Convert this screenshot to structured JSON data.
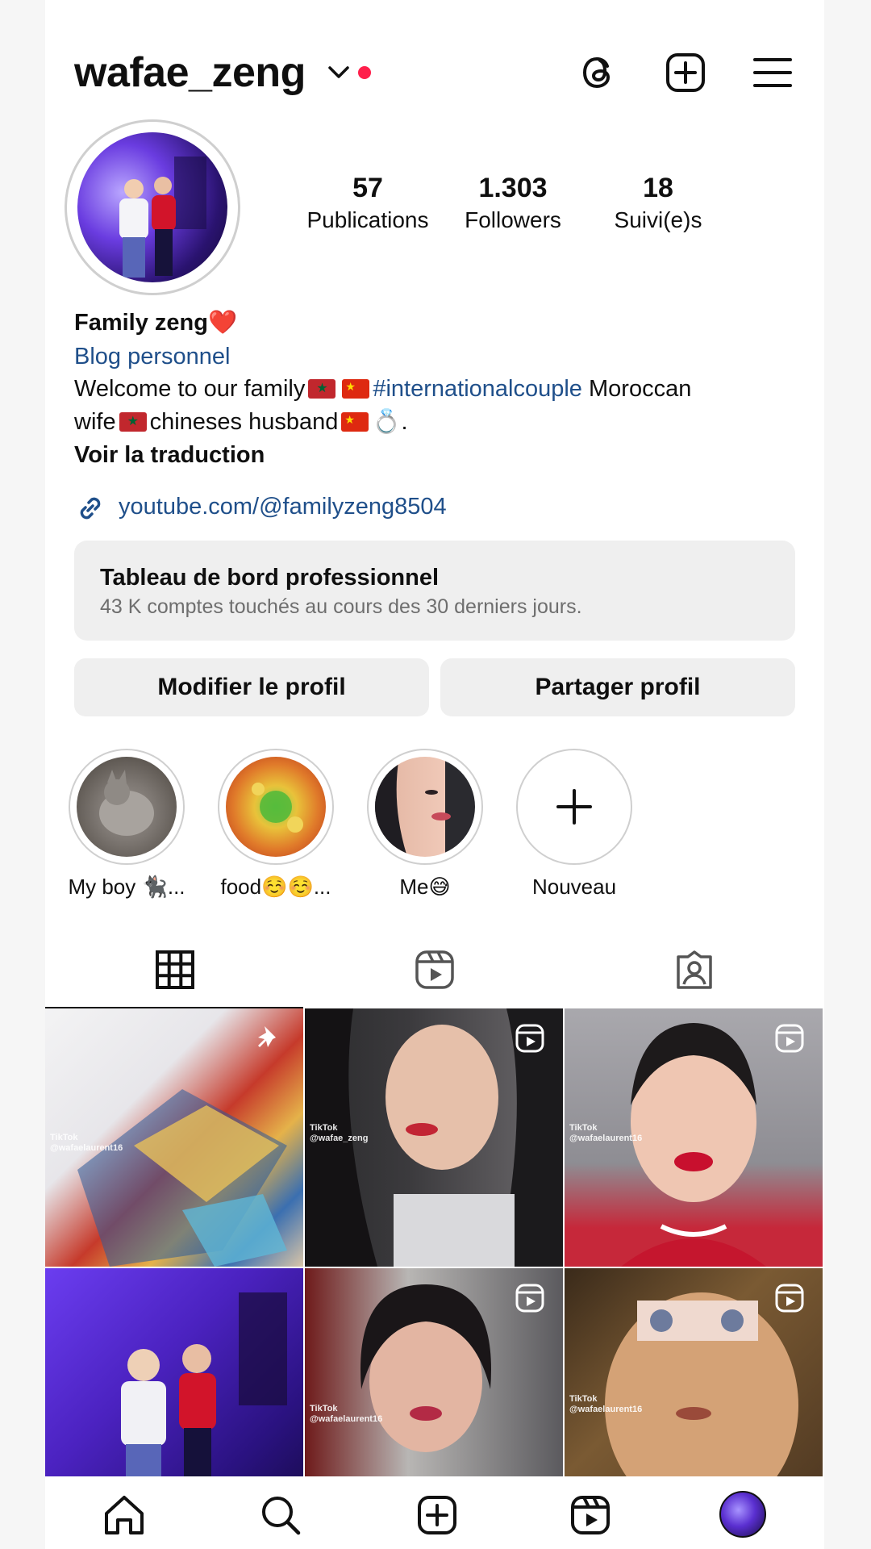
{
  "header": {
    "username": "wafae_zeng",
    "icons": [
      "threads-icon",
      "create-icon",
      "menu-icon"
    ]
  },
  "profile": {
    "stats": [
      {
        "value": "57",
        "label": "Publications"
      },
      {
        "value": "1.303",
        "label": "Followers"
      },
      {
        "value": "18",
        "label": "Suivi(e)s"
      }
    ],
    "name": "Family zeng",
    "name_emoji": "❤️",
    "category": "Blog personnel",
    "bio_part1": "Welcome to our family",
    "bio_hashtag": "#internationalcouple",
    "bio_part2": " Moroccan",
    "bio_part3": "wife",
    "bio_part4": "chineses husband",
    "bio_ring": "💍",
    "bio_end": ".",
    "translate": "Voir la traduction",
    "link": "youtube.com/@familyzeng8504"
  },
  "dashboard": {
    "title": "Tableau de bord professionnel",
    "subtitle": "43 K comptes touchés au cours des 30 derniers jours."
  },
  "buttons": {
    "edit": "Modifier le profil",
    "share": "Partager profil"
  },
  "highlights": [
    {
      "label": "My boy 🐈‍⬛..."
    },
    {
      "label": "food☺️☺️..."
    },
    {
      "label": "Me😅"
    },
    {
      "label": "Nouveau"
    }
  ],
  "tabs": [
    "grid-icon",
    "reels-icon",
    "tagged-icon"
  ],
  "grid": [
    {
      "tiktok": "TikTok",
      "handle": "@wafaelaurent16"
    },
    {
      "tiktok": "TikTok",
      "handle": "@wafae_zeng"
    },
    {
      "tiktok": "TikTok",
      "handle": "@wafaelaurent16"
    },
    {
      "tiktok": "",
      "handle": ""
    },
    {
      "tiktok": "TikTok",
      "handle": "@wafaelaurent16"
    },
    {
      "tiktok": "TikTok",
      "handle": "@wafaelaurent16"
    }
  ],
  "nav": [
    "home-icon",
    "search-icon",
    "create-icon",
    "reels-icon",
    "profile-avatar"
  ]
}
